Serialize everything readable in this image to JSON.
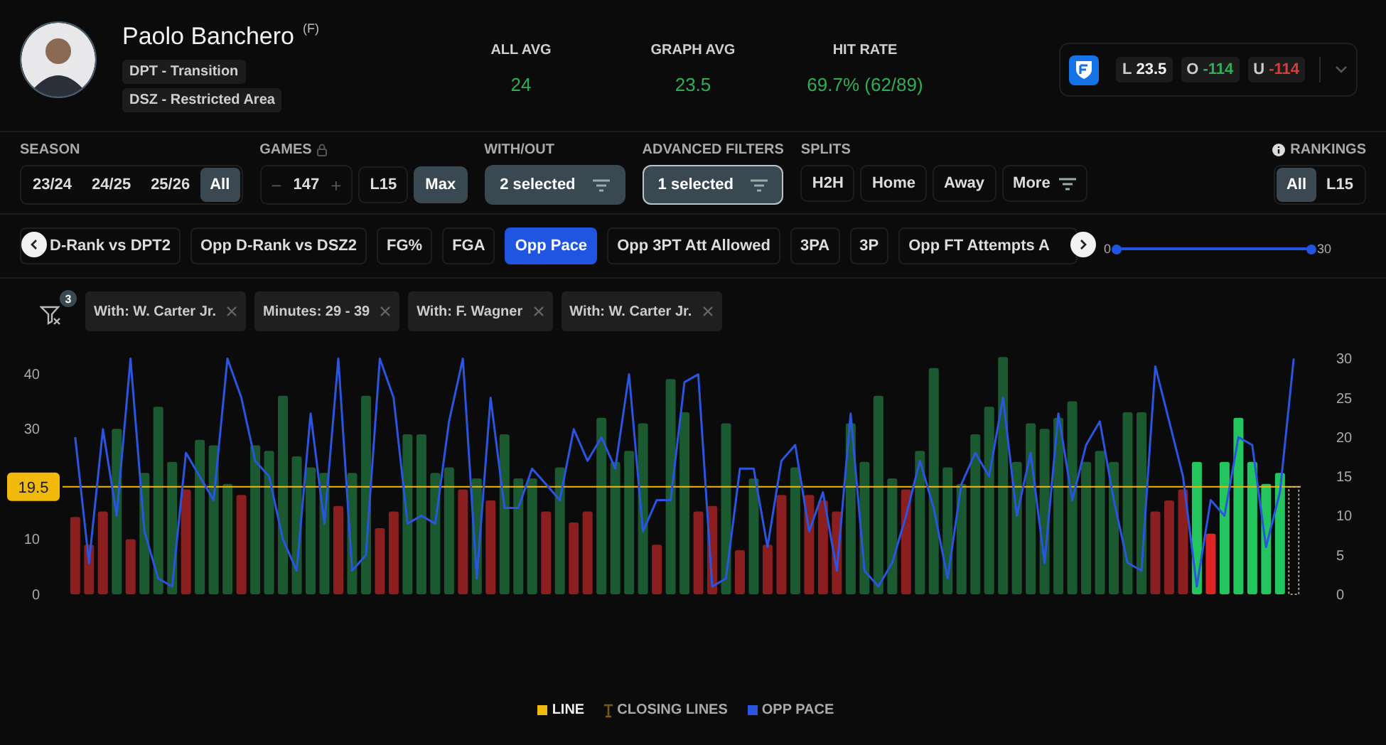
{
  "player": {
    "name": "Paolo Banchero",
    "position": "(F)",
    "tags": [
      "DPT - Transition",
      "DSZ - Restricted Area"
    ]
  },
  "stats": [
    {
      "label": "ALL AVG",
      "value": "24"
    },
    {
      "label": "GRAPH AVG",
      "value": "23.5"
    },
    {
      "label": "HIT RATE",
      "value": "69.7% (62/89)"
    }
  ],
  "sportsbook": {
    "line_label": "L",
    "line": "23.5",
    "over_label": "O",
    "over": "-114",
    "under_label": "U",
    "under": "-114"
  },
  "filters": {
    "season": {
      "label": "SEASON",
      "options": [
        {
          "label": "23/24",
          "selected": false
        },
        {
          "label": "24/25",
          "selected": false
        },
        {
          "label": "25/26",
          "selected": false
        },
        {
          "label": "All",
          "selected": true
        }
      ]
    },
    "games": {
      "label": "GAMES",
      "minus": "−",
      "count": "147",
      "plus": "+",
      "options": [
        {
          "label": "L15",
          "selected": false
        },
        {
          "label": "Max",
          "selected": true
        }
      ]
    },
    "with_out": {
      "label": "WITH/OUT",
      "value": "2 selected",
      "kind": "filled"
    },
    "advanced": {
      "label": "ADVANCED FILTERS",
      "value": "1 selected",
      "kind": "outlined"
    },
    "splits": {
      "label": "SPLITS",
      "options": [
        {
          "label": "H2H",
          "selected": false,
          "kind": "plain"
        },
        {
          "label": "Home",
          "selected": false,
          "kind": "plain"
        },
        {
          "label": "Away",
          "selected": false,
          "kind": "plain"
        },
        {
          "label": "More",
          "selected": false,
          "kind": "menu"
        }
      ]
    },
    "rankings": {
      "label": "RANKINGS",
      "options": [
        {
          "label": "All",
          "selected": true
        },
        {
          "label": "L15",
          "selected": false
        }
      ]
    }
  },
  "stat_chips": [
    {
      "label": "D-Rank vs DPT2",
      "selected": false
    },
    {
      "label": "Opp D-Rank vs DSZ2",
      "selected": false
    },
    {
      "label": "FG%",
      "selected": false
    },
    {
      "label": "FGA",
      "selected": false
    },
    {
      "label": "Opp Pace",
      "selected": true
    },
    {
      "label": "Opp 3PT Att Allowed",
      "selected": false
    },
    {
      "label": "3PA",
      "selected": false
    },
    {
      "label": "3P",
      "selected": false
    },
    {
      "label": "Opp FT Attempts A",
      "selected": false
    }
  ],
  "pace_range": {
    "min": "0",
    "max": "30",
    "level": 1
  },
  "active_filters": {
    "count": "3",
    "chips": [
      "With: W. Carter Jr.",
      "Minutes: 29 - 39",
      "With: F. Wagner",
      "With: W. Carter Jr."
    ]
  },
  "chart": {
    "chart_data": {
      "type": "bar",
      "ylim": [
        0,
        43.3
      ],
      "yticks": [
        0,
        10,
        30,
        40
      ],
      "y2lim": [
        0,
        30.4
      ],
      "y2ticks": [
        0,
        5,
        10,
        15,
        20,
        25,
        30
      ],
      "series": [
        {
          "color": "#1b5a30",
          "values": [
            null,
            null,
            null,
            30,
            null,
            22,
            34,
            24,
            null,
            28,
            27,
            20,
            null,
            27,
            26,
            36,
            25,
            23,
            22,
            null,
            22,
            36,
            null,
            null,
            29,
            29,
            22,
            23,
            null,
            21,
            null,
            29,
            21,
            21,
            null,
            23,
            null,
            null,
            32,
            24,
            26,
            31,
            null,
            39,
            33,
            null,
            null,
            31,
            null,
            21,
            null,
            null,
            23,
            null,
            null,
            null,
            31,
            24,
            36,
            21,
            null,
            26,
            41,
            23,
            20,
            29,
            34,
            43,
            24,
            31,
            30,
            32,
            35,
            24,
            26,
            24,
            33,
            33,
            null,
            null,
            null,
            null,
            null,
            null,
            null,
            null,
            null,
            null,
            null
          ]
        },
        {
          "color": "#8b1e1e",
          "values": [
            14,
            9,
            15,
            null,
            10,
            null,
            null,
            null,
            19,
            null,
            null,
            null,
            18,
            null,
            null,
            null,
            null,
            null,
            null,
            16,
            null,
            null,
            12,
            15,
            null,
            null,
            null,
            null,
            19,
            null,
            17,
            null,
            null,
            null,
            15,
            null,
            13,
            15,
            null,
            null,
            null,
            null,
            9,
            null,
            null,
            15,
            16,
            null,
            8,
            null,
            9,
            18,
            null,
            18,
            17,
            15,
            null,
            null,
            null,
            null,
            19,
            null,
            null,
            null,
            null,
            null,
            null,
            null,
            null,
            null,
            null,
            null,
            null,
            null,
            null,
            null,
            null,
            null,
            15,
            17,
            19,
            null,
            null,
            null,
            null,
            null,
            null,
            null,
            null
          ]
        },
        {
          "color": "#22c55e",
          "values": [
            null,
            null,
            null,
            null,
            null,
            null,
            null,
            null,
            null,
            null,
            null,
            null,
            null,
            null,
            null,
            null,
            null,
            null,
            null,
            null,
            null,
            null,
            null,
            null,
            null,
            null,
            null,
            null,
            null,
            null,
            null,
            null,
            null,
            null,
            null,
            null,
            null,
            null,
            null,
            null,
            null,
            null,
            null,
            null,
            null,
            null,
            null,
            null,
            null,
            null,
            null,
            null,
            null,
            null,
            null,
            null,
            null,
            null,
            null,
            null,
            null,
            null,
            null,
            null,
            null,
            null,
            null,
            null,
            null,
            null,
            null,
            null,
            null,
            null,
            null,
            null,
            null,
            null,
            null,
            null,
            null,
            24,
            null,
            24,
            32,
            24,
            20,
            22,
            null
          ]
        },
        {
          "color": "#e02424",
          "values": [
            null,
            null,
            null,
            null,
            null,
            null,
            null,
            null,
            null,
            null,
            null,
            null,
            null,
            null,
            null,
            null,
            null,
            null,
            null,
            null,
            null,
            null,
            null,
            null,
            null,
            null,
            null,
            null,
            null,
            null,
            null,
            null,
            null,
            null,
            null,
            null,
            null,
            null,
            null,
            null,
            null,
            null,
            null,
            null,
            null,
            null,
            null,
            null,
            null,
            null,
            null,
            null,
            null,
            null,
            null,
            null,
            null,
            null,
            null,
            null,
            null,
            null,
            null,
            null,
            null,
            null,
            null,
            null,
            null,
            null,
            null,
            null,
            null,
            null,
            null,
            null,
            null,
            null,
            null,
            null,
            null,
            null,
            11,
            null,
            null,
            null,
            null,
            null,
            null
          ]
        },
        {
          "name": "OPP PACE",
          "type": "line",
          "axis": "y2",
          "color": "#2a55e0",
          "values": [
            20,
            4,
            21,
            10,
            30,
            8,
            2,
            1,
            18,
            15,
            12,
            30,
            25,
            17,
            15,
            7,
            3,
            23,
            9,
            30,
            3,
            5,
            30,
            25,
            9,
            10,
            9,
            22,
            30,
            2,
            25,
            11,
            11,
            16,
            14,
            12,
            21,
            17,
            20,
            16,
            28,
            8,
            12,
            12,
            27,
            28,
            1,
            2,
            16,
            16,
            6,
            17,
            19,
            8,
            13,
            3,
            23,
            3,
            1,
            4,
            10,
            17,
            11,
            2,
            14,
            18,
            15,
            25,
            10,
            18,
            4,
            23,
            12,
            19,
            22,
            12,
            4,
            3,
            29,
            22,
            15,
            1,
            12,
            10,
            20,
            19,
            6,
            13,
            30
          ]
        }
      ],
      "ref_lines": [
        {
          "axis": "y",
          "value": 19.5,
          "label": "19.5",
          "color": "#f0b90b"
        }
      ]
    }
  },
  "legend": [
    {
      "label": "LINE",
      "kind": "square",
      "color": "#f0b90b"
    },
    {
      "label": "CLOSING LINES",
      "kind": "marker"
    }
  ]
}
